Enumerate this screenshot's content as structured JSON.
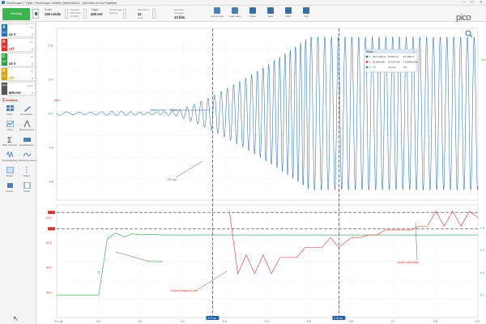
{
  "window": {
    "title": "PicoScope 7 T&M - PicoScope 3408E (3000/3002) - 500 MHz 5 G/s FastRes"
  },
  "toolbar": {
    "run_label": "Running",
    "scope": {
      "label": "Scope",
      "value": "100 ns/div",
      "sub": "5 GS/s"
    },
    "samples": {
      "label": "Samples",
      "value": "100 kS/ch",
      "sub": "10 GS/s"
    },
    "trigger": {
      "label": "Trigger",
      "value": "400 mV",
      "sub": "Simple edge",
      "sub2": "A Rising"
    },
    "waveforms": {
      "label": "Waveforms",
      "value": "32",
      "sub": "of 32"
    },
    "hardware": {
      "label": "Hardware",
      "value": "10 bits",
      "sub": "resolution"
    },
    "icons": [
      {
        "name": "instruments-icon",
        "label": "Instruments",
        "color": "#4c7fb5"
      },
      {
        "name": "load-setup-icon",
        "label": "Load setup",
        "color": "#4c7fb5"
      },
      {
        "name": "open-icon",
        "label": "Open",
        "color": "#3a6ea5"
      },
      {
        "name": "save-icon",
        "label": "Save",
        "color": "#3a6ea5"
      },
      {
        "name": "print-icon",
        "label": "Print",
        "color": "#3a6ea5"
      },
      {
        "name": "full-icon",
        "label": "Full",
        "color": "#3a6ea5"
      }
    ],
    "logo": "pico",
    "logo_sub": "Technology"
  },
  "channels": [
    {
      "letter": "A",
      "coupling": "DC",
      "range": "±1 V",
      "color": "#2a6fb5",
      "mini": "1X"
    },
    {
      "letter": "B",
      "coupling": "DC",
      "range": "Off",
      "color": "#d9322b",
      "mini": "1X"
    },
    {
      "letter": "C",
      "coupling": "DC",
      "range": "±2 V",
      "color": "#2f9e45",
      "mini": "1X"
    },
    {
      "letter": "D",
      "coupling": "DC",
      "range": "Off",
      "color": "#d4a412",
      "mini": "1X"
    },
    {
      "letter": "Gen",
      "coupling": "",
      "range": "500 mV",
      "color": "#555555",
      "mini": "2 MHz"
    }
  ],
  "tools_header": "Analysis",
  "tools": [
    {
      "name": "tool-views",
      "label": "Views"
    },
    {
      "name": "tool-annotations",
      "label": "Annotations"
    },
    {
      "name": "tool-views2",
      "label": "Views"
    },
    {
      "name": "tool-measurements",
      "label": "Measurements"
    },
    {
      "name": "tool-math-channels",
      "label": "Math channels"
    },
    {
      "name": "tool-deep-measure",
      "label": "DeepMeasure"
    },
    {
      "name": "tool-serial-decoding",
      "label": "Serial decoding"
    },
    {
      "name": "tool-reference-waveforms",
      "label": "Reference waveforms"
    },
    {
      "name": "tool-masks",
      "label": "Masks"
    },
    {
      "name": "tool-rulers",
      "label": "Rulers"
    },
    {
      "name": "tool-actions",
      "label": "Actions"
    },
    {
      "name": "tool-notes",
      "label": "Notes"
    }
  ],
  "colors": {
    "blue": "#2a6fb5",
    "red": "#d9322b",
    "green": "#2f9e45",
    "cursor": "#555555",
    "ruler_chip": "#1f5fa8"
  },
  "chart_data": {
    "type": "line",
    "x_axis": {
      "unit": "µs",
      "range": [
        -0.1,
        0.9
      ],
      "tick_labels": [
        "-0.1 µs",
        "0.0",
        "0.1",
        "0.2",
        "0.3",
        "0.4",
        "0.5",
        "0.6",
        "0.7",
        "0.8",
        "0.9"
      ]
    },
    "top_panel": {
      "left_axis_unit": "V",
      "left_tick_labels": [
        "0.8",
        "0.4",
        "0.0",
        "-0.4",
        "-0.8"
      ],
      "left_range": [
        -1.0,
        1.0
      ],
      "series": [
        {
          "name": "RF out",
          "channel": "A",
          "amplitude_start": 0.02,
          "amplitude_end": 0.9,
          "settle_start_us": 0.17,
          "settle_end_us": 0.5,
          "freq_start_mhz": 35,
          "freq_end_mhz": 62
        }
      ],
      "annotations": [
        "Settling time ~ 300ns",
        "RF out"
      ],
      "right_tick_labels": [
        "MHz",
        "64.0"
      ]
    },
    "bottom_panel": {
      "left_axis_unit": "MHz",
      "left_tick_labels": [
        "64.0",
        "62.0",
        "60.0",
        "58.0"
      ],
      "left_range": [
        56.0,
        65.0
      ],
      "right_axis_unit": "V",
      "right_tick_labels": [
        "1.8",
        "1.2",
        "0.6",
        "0.0"
      ],
      "right_range": [
        -0.6,
        2.4
      ],
      "series": [
        {
          "name": "VCO tune",
          "channel": "C",
          "axis": "right",
          "x": [
            -0.1,
            0.0,
            0.02,
            0.04,
            0.06,
            0.08,
            0.1,
            0.12,
            0.15,
            0.2,
            0.9
          ],
          "y": [
            0.0,
            0.0,
            1.5,
            1.65,
            1.55,
            1.63,
            1.6,
            1.62,
            1.6,
            1.6,
            1.6
          ]
        },
        {
          "name": "Output frequency plot",
          "channel": "Math",
          "axis": "left",
          "x": [
            0.31,
            0.32,
            0.33,
            0.35,
            0.37,
            0.39,
            0.41,
            0.43,
            0.45,
            0.47,
            0.49,
            0.51,
            0.53,
            0.55,
            0.57,
            0.6,
            0.62,
            0.64,
            0.66,
            0.68,
            0.7,
            0.72,
            0.74,
            0.76,
            0.78,
            0.8,
            0.82,
            0.84,
            0.86,
            0.88,
            0.9
          ],
          "y": [
            64.5,
            62.0,
            59.5,
            61.0,
            59.5,
            61.0,
            59.5,
            60.8,
            60.8,
            60.8,
            61.6,
            61.6,
            61.6,
            62.4,
            61.6,
            62.4,
            62.4,
            62.6,
            62.6,
            63.0,
            63.0,
            63.0,
            63.0,
            63.3,
            63.3,
            64.5,
            63.3,
            64.5,
            63.3,
            64.5,
            64.0
          ]
        }
      ],
      "annotations": [
        "VCO tune",
        "Output frequency plot",
        "Cycle-Cycle jitter"
      ],
      "reference_lines_mhz": [
        64.4,
        63.1
      ]
    },
    "cursors": {
      "time_labels": [
        "0.27 µs",
        "0.57 µs"
      ],
      "x_us": [
        0.27,
        0.57
      ],
      "ruler_table": {
        "header": "Rulers",
        "rows": [
          {
            "label": "1",
            "col1": "323.1 389 ns",
            "col2": "5.2186 ms",
            "col3": "91.7/86 ns"
          },
          {
            "label": "2",
            "col1": "65.088 MHz",
            "col2": "65.424 GHz",
            "col3": "1.024659 MHz"
          },
          {
            "label": "3",
            "col1": "1.0",
            "col2": "-8.1 mV",
            "col3": "4.8"
          }
        ]
      }
    }
  }
}
